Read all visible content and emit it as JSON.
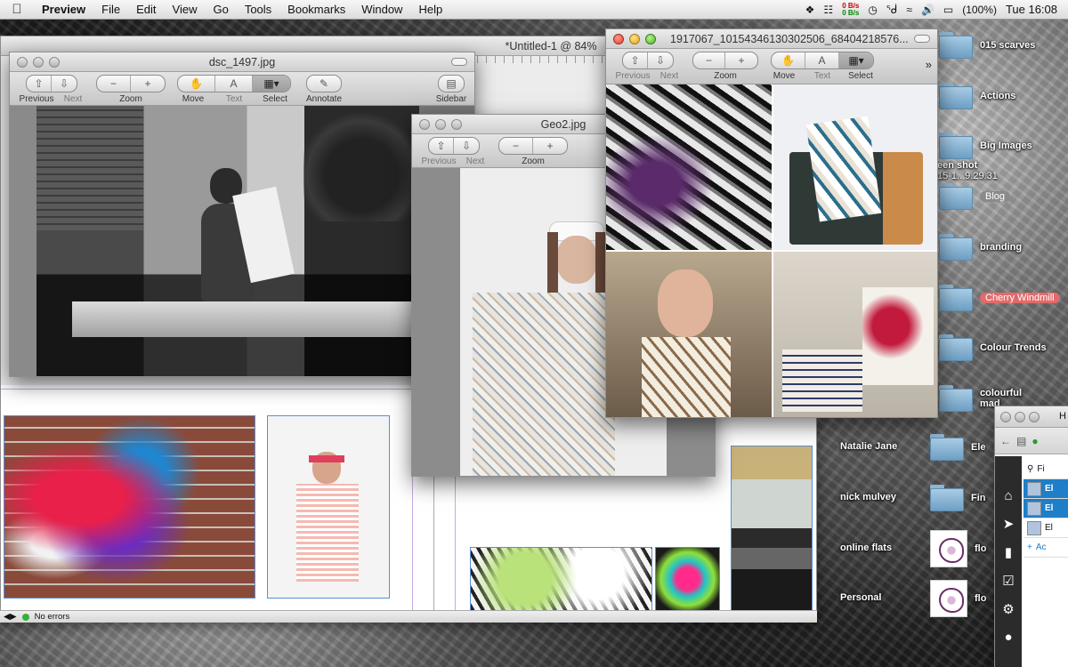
{
  "menubar": {
    "app": "Preview",
    "items": [
      "File",
      "Edit",
      "View",
      "Go",
      "Tools",
      "Bookmarks",
      "Window",
      "Help"
    ],
    "net_up": "0 B/s",
    "net_down": "0 B/s",
    "battery": "(100%)",
    "clock": "Tue 16:08"
  },
  "windows": {
    "untitled": {
      "title": "*Untitled-1 @ 84%"
    },
    "dsc": {
      "title": "dsc_1497.jpg",
      "labels": {
        "previous": "Previous",
        "next": "Next",
        "zoom": "Zoom",
        "move": "Move",
        "text": "Text",
        "select": "Select",
        "annotate": "Annotate",
        "sidebar": "Sidebar"
      }
    },
    "geo2": {
      "title": "Geo2.jpg",
      "labels": {
        "previous": "Previous",
        "next": "Next",
        "zoom": "Zoom"
      }
    },
    "collage": {
      "title": "1917067_10154346130302506_68404218576...",
      "labels": {
        "previous": "Previous",
        "next": "Next",
        "zoom": "Zoom",
        "move": "Move",
        "text": "Text",
        "select": "Select"
      }
    }
  },
  "statusbar": {
    "text": "No errors"
  },
  "desktop": {
    "screenshot_label_1": "een shot",
    "screenshot_label_2": "15-1...9.29.31",
    "items": [
      {
        "label": "015 scarves",
        "style": ""
      },
      {
        "label": "Actions",
        "style": ""
      },
      {
        "label": "Big Images",
        "style": ""
      },
      {
        "label": "Blog",
        "style": "tag-grey"
      },
      {
        "label": "branding",
        "style": ""
      },
      {
        "label": "Cherry Windmill",
        "style": "tag-red"
      },
      {
        "label": "Colour Trends",
        "style": ""
      },
      {
        "label": "colourful",
        "style": ""
      }
    ],
    "colourful_line2": "mad",
    "left_items": [
      {
        "label": "Natalie Jane"
      },
      {
        "label": "nick mulvey"
      },
      {
        "label": "online flats"
      },
      {
        "label": "Personal"
      }
    ],
    "partial_right": [
      "Ele",
      "Fin",
      "flo",
      "flo"
    ]
  },
  "sideapp": {
    "tab_initial": "H",
    "search_initial": "Fi",
    "rows": [
      "El",
      "El",
      "El",
      "Ac"
    ]
  }
}
